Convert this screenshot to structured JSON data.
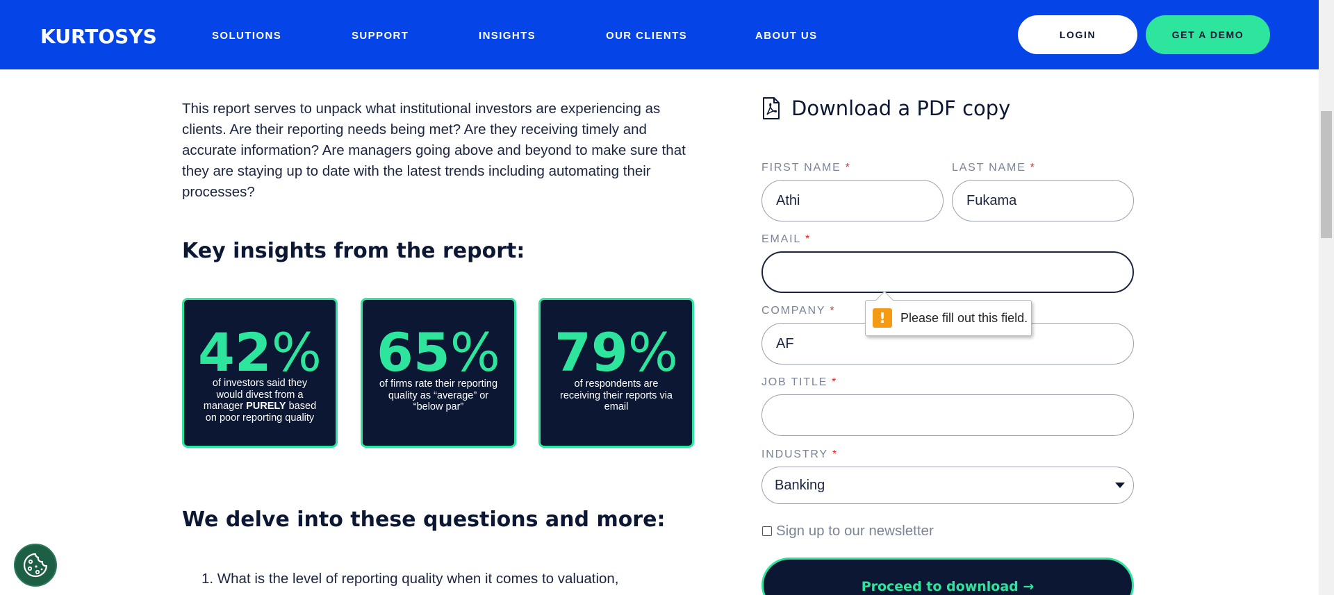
{
  "header": {
    "logo_text": "KURTOSYS",
    "nav": [
      {
        "label": "SOLUTIONS"
      },
      {
        "label": "SUPPORT"
      },
      {
        "label": "INSIGHTS"
      },
      {
        "label": "OUR CLIENTS"
      },
      {
        "label": "ABOUT US"
      }
    ],
    "login_label": "LOGIN",
    "demo_label": "GET A DEMO",
    "colors": {
      "header_bg": "#0544e6",
      "accent": "#2ee59d",
      "navy": "#0b1733"
    }
  },
  "content": {
    "intro": "This report serves to unpack what institutional investors are experiencing as clients. Are their reporting needs being met? Are they receiving timely and accurate information? Are managers going above and beyond to make sure that they are staying up to date with the latest trends including automating their processes?",
    "key_insights_heading": "Key insights from the report:",
    "stats": [
      {
        "number": "42",
        "unit": "%",
        "desc_before": "of investors said they would divest from a manager ",
        "desc_bold": "PURELY",
        "desc_after": " based on poor reporting quality"
      },
      {
        "number": "65",
        "unit": "%",
        "desc_before": "of firms rate their reporting quality as “average” or “below par”",
        "desc_bold": "",
        "desc_after": ""
      },
      {
        "number": "79",
        "unit": "%",
        "desc_before": "of respondents are receiving their reports via email",
        "desc_bold": "",
        "desc_after": ""
      }
    ],
    "delve_heading": "We delve into these questions and more:",
    "list_item_1": "1. What is the level of reporting quality when it comes to valuation,"
  },
  "form": {
    "title": "Download a PDF copy",
    "required_mark": "*",
    "first_name": {
      "label": "FIRST NAME",
      "value": "Athi"
    },
    "last_name": {
      "label": "LAST NAME",
      "value": "Fukama"
    },
    "email": {
      "label": "EMAIL",
      "value": ""
    },
    "company": {
      "label": "COMPANY",
      "value": "AF"
    },
    "job_title": {
      "label": "JOB TITLE",
      "value": ""
    },
    "industry": {
      "label": "INDUSTRY",
      "value": "Banking"
    },
    "newsletter_label": "Sign up to our newsletter",
    "newsletter_checked": false,
    "submit_label": "Proceed to download →",
    "validation_message": "Please fill out this field.",
    "validation_icon": "!"
  },
  "icons": {
    "pdf": "pdf-file-icon",
    "warning": "warning-icon",
    "cookie": "cookie-icon",
    "chevron": "chevron-down-icon"
  }
}
